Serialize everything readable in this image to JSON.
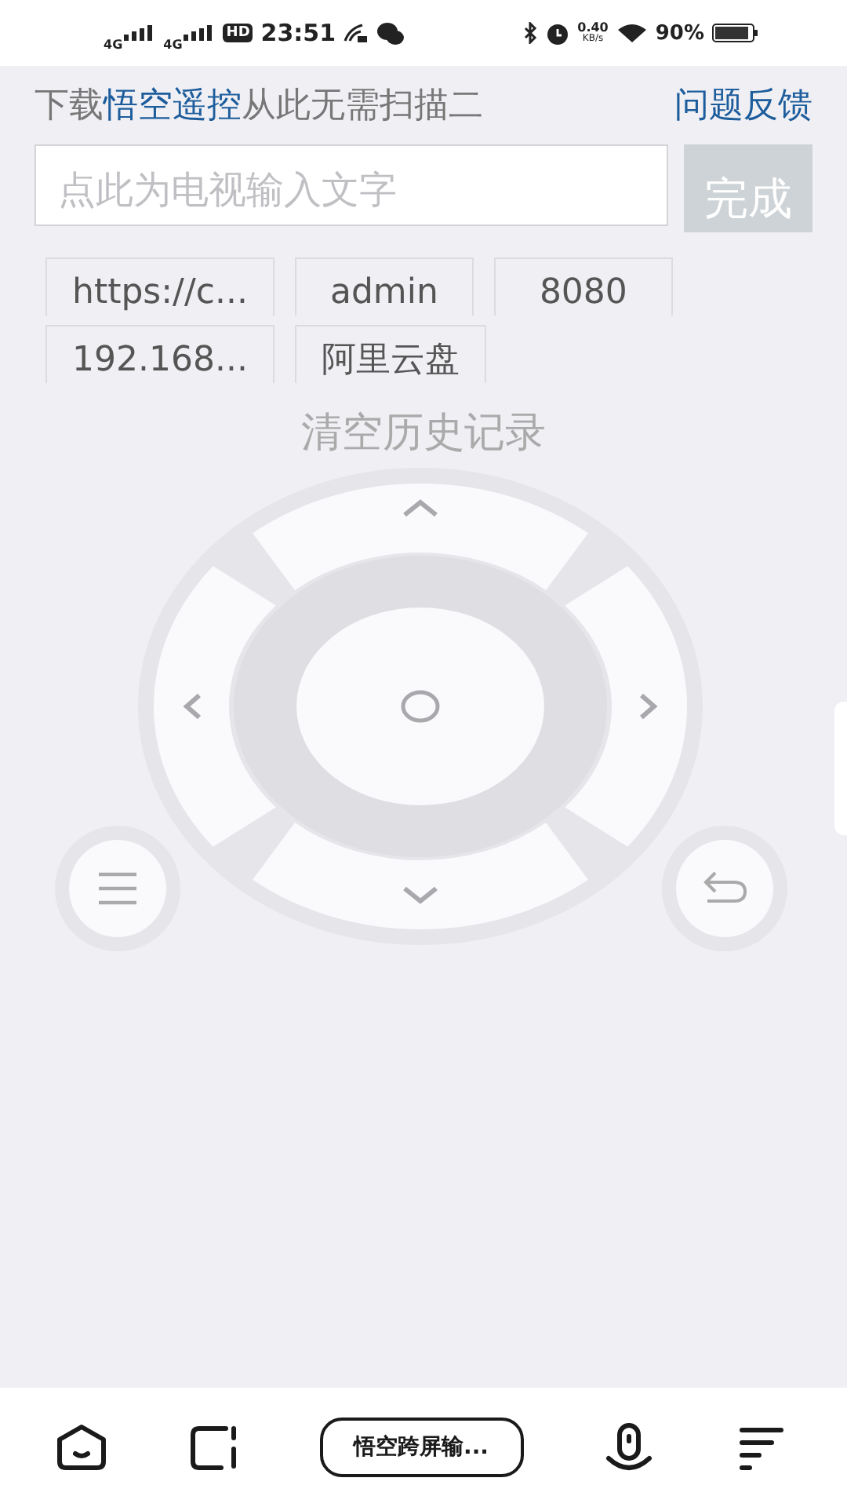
{
  "status_bar": {
    "signal_labels": [
      "4G",
      "4G"
    ],
    "hd_label": "HD",
    "time": "23:51",
    "speed": "0.40",
    "speed_unit": "KB/s",
    "battery": "90%"
  },
  "banner": {
    "prefix": "下载",
    "app_link": "悟空遥控",
    "suffix": "从此无需扫描二",
    "feedback_link": "问题反馈"
  },
  "input": {
    "placeholder": "点此为电视输入文字",
    "submit_button": "完成"
  },
  "history": [
    {
      "label": "https://c..."
    },
    {
      "label": "admin"
    },
    {
      "label": "8080"
    },
    {
      "label": "192.168..."
    },
    {
      "label": "阿里云盘"
    }
  ],
  "clear_history": "清空历史记录",
  "bottom_nav": {
    "center_button": "悟空跨屏输..."
  }
}
